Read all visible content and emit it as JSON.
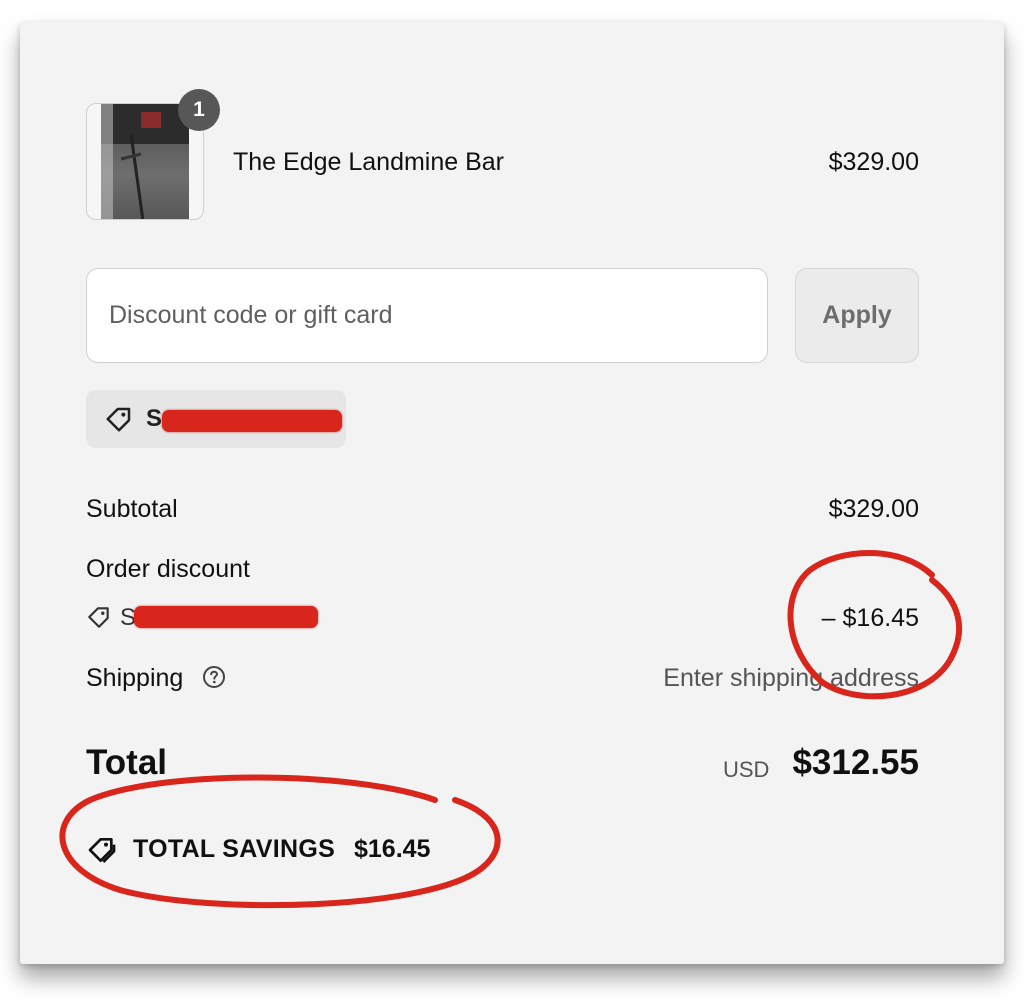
{
  "cart": {
    "item": {
      "name": "The Edge Landmine Bar",
      "price": "$329.00",
      "quantity": "1",
      "image": "product-photo"
    }
  },
  "discount": {
    "placeholder": "Discount code or gift card",
    "value": "",
    "apply_label": "Apply",
    "applied_code_visible": "S",
    "applied_code_redacted": true
  },
  "summary": {
    "subtotal_label": "Subtotal",
    "subtotal_value": "$329.00",
    "order_discount_label": "Order discount",
    "order_discount_code_visible": "S",
    "order_discount_value": "– $16.45",
    "shipping_label": "Shipping",
    "shipping_value": "Enter shipping address",
    "total_label": "Total",
    "currency": "USD",
    "total_value": "$312.55",
    "savings_label": "TOTAL SAVINGS",
    "savings_value": "$16.45"
  },
  "colors": {
    "annotation_red": "#d8261c",
    "panel_bg": "#f3f3f3",
    "badge_bg": "#575757"
  },
  "icons": [
    "tag-icon",
    "help-circle-icon",
    "savings-tag-icon"
  ]
}
